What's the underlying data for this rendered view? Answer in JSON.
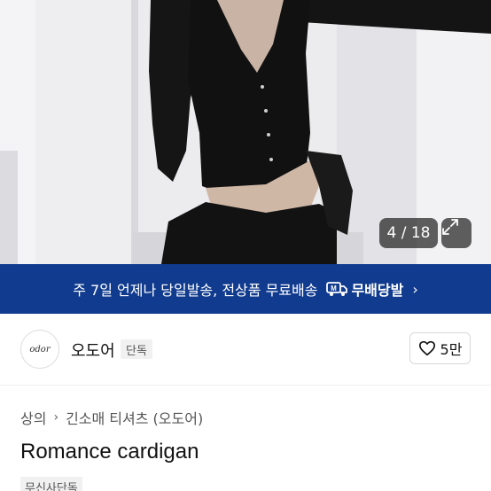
{
  "gallery": {
    "counter": "4 / 18",
    "expand_icon": "expand-icon"
  },
  "promo": {
    "message": "주 7일 언제나 당일발송, 전상품 무료배송",
    "service_icon": "truck-icon",
    "service_name": "무배당발",
    "chevron": "›",
    "background": "#113b8e"
  },
  "brand": {
    "logo_text": "odor",
    "name": "오도어",
    "tag": "단독",
    "like_icon": "heart-icon",
    "like_count": "5만"
  },
  "breadcrumb": {
    "items": [
      "상의",
      "긴소매 티셔츠 (오도어)"
    ],
    "separator": "›"
  },
  "product": {
    "title": "Romance cardigan",
    "tag": "무신사단독"
  }
}
